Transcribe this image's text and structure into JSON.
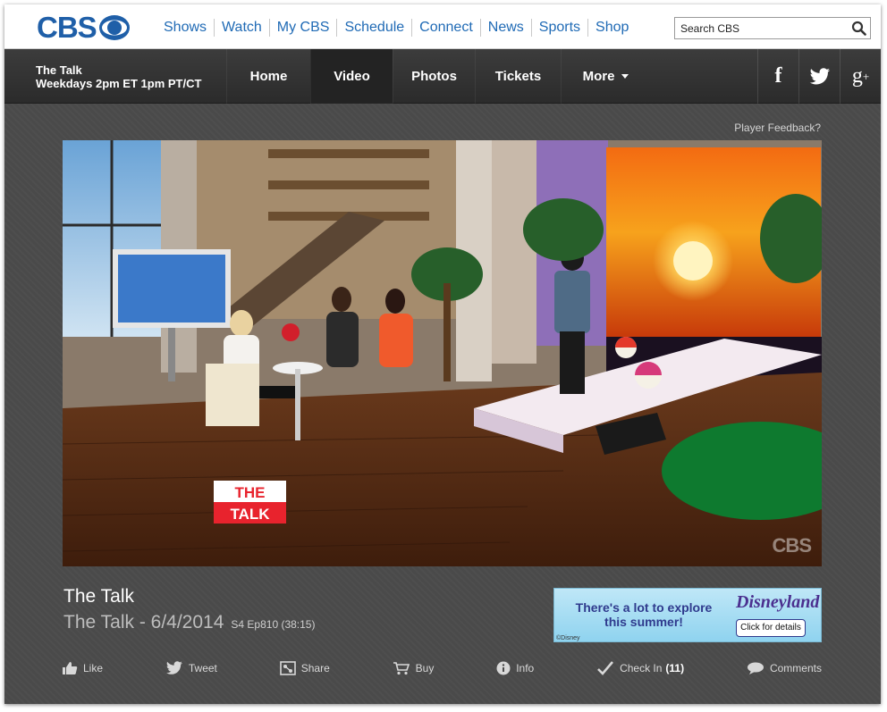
{
  "brand": {
    "logo": "CBS",
    "logo_color": "#1f5fa8"
  },
  "top_nav": [
    "Shows",
    "Watch",
    "My CBS",
    "Schedule",
    "Connect",
    "News",
    "Sports",
    "Shop"
  ],
  "search": {
    "placeholder": "Search CBS",
    "icon": "search-icon"
  },
  "show": {
    "title": "The Talk",
    "schedule": "Weekdays 2pm ET 1pm PT/CT"
  },
  "show_nav": {
    "items": [
      "Home",
      "Video",
      "Photos",
      "Tickets",
      "More"
    ],
    "active": "Video"
  },
  "social": [
    "facebook-icon",
    "twitter-icon",
    "google-plus-icon"
  ],
  "player": {
    "feedback": "Player Feedback?",
    "badge_line1": "THE",
    "badge_line2": "TALK",
    "watermark": "CBS"
  },
  "episode": {
    "show": "The Talk",
    "title": "The Talk - 6/4/2014",
    "meta": "S4 Ep810 (38:15)"
  },
  "ad": {
    "headline_1": "There's a lot to explore",
    "headline_2": "this summer!",
    "brand": "Disneyland",
    "cta": "Click for details",
    "fine": "©Disney"
  },
  "actions": {
    "like": "Like",
    "tweet": "Tweet",
    "share": "Share",
    "buy": "Buy",
    "info": "Info",
    "checkin": "Check In",
    "checkin_count": "(11)",
    "comments": "Comments"
  }
}
